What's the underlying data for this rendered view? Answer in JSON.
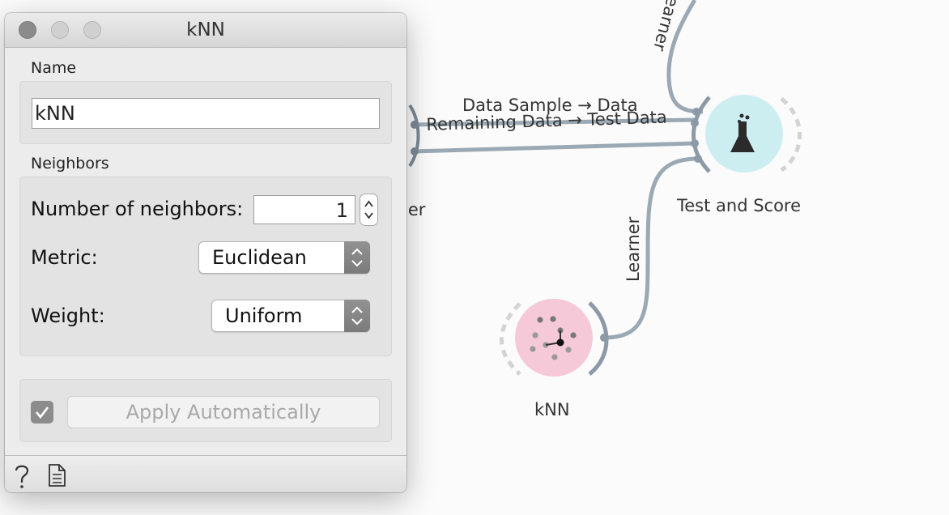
{
  "canvas": {
    "edges": [
      {
        "label": "Data Sample → Data"
      },
      {
        "label": "Remaining Data → Test Data"
      },
      {
        "label": "Learner"
      },
      {
        "label": "Learner"
      }
    ],
    "nodes": [
      {
        "title": "Test and Score",
        "icon": "flask-icon",
        "color": "#cdeef0"
      },
      {
        "title": "kNN",
        "icon": "knn-icon",
        "color": "#f6c9d8"
      },
      {
        "title": "ler",
        "icon": "data-sampler-icon"
      }
    ]
  },
  "window": {
    "title": "kNN",
    "name_section": {
      "label": "Name",
      "value": "kNN"
    },
    "neighbors_section": {
      "label": "Neighbors",
      "num_neighbors_label": "Number of neighbors:",
      "num_neighbors_value": "1",
      "metric_label": "Metric:",
      "metric_value": "Euclidean",
      "weight_label": "Weight:",
      "weight_value": "Uniform"
    },
    "apply": {
      "label": "Apply Automatically",
      "checked": true
    },
    "status_icons": [
      "help-icon",
      "report-icon"
    ]
  }
}
